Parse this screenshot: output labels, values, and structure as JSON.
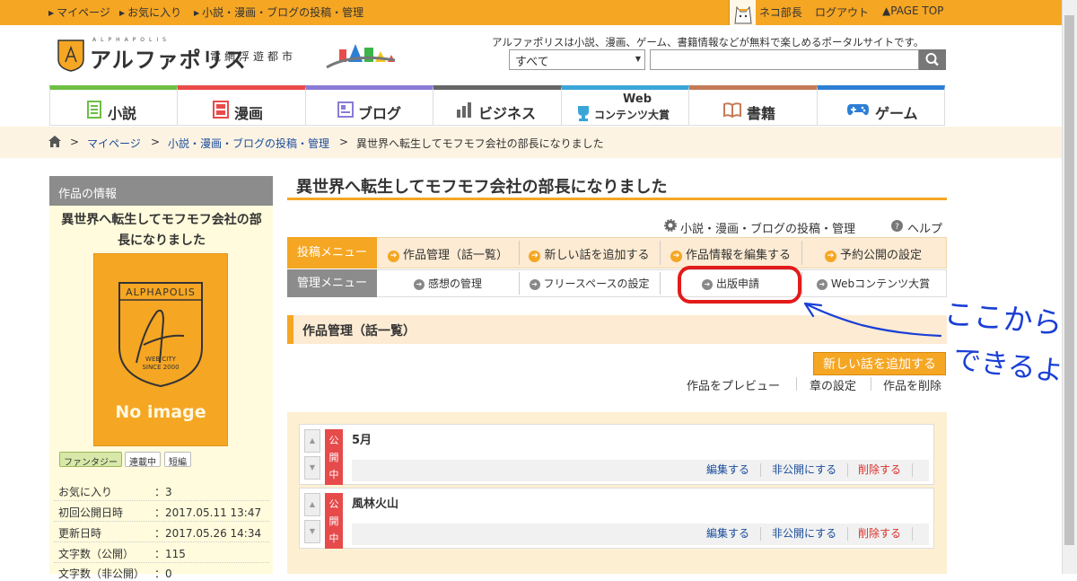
{
  "topbar": {
    "links": [
      "マイページ",
      "お気に入り",
      "小説・漫画・ブログの投稿・管理"
    ],
    "username": "ネコ部長",
    "logout": "ログアウト",
    "pagetop": "▲PAGE TOP"
  },
  "header": {
    "logo_small": "ALPHAPOLIS",
    "logo_name": "アルファポリス",
    "logo_sub": "電網浮遊都市",
    "tagline": "アルファポリスは小説、漫画、ゲーム、書籍情報などが無料で楽しめるポータルサイトです。",
    "search_select": "すべて"
  },
  "nav": [
    "小説",
    "漫画",
    "ブログ",
    "ビジネス",
    "Web",
    "コンテンツ大賞",
    "書籍",
    "ゲーム"
  ],
  "breadcrumb": [
    "マイページ",
    "小説・漫画・ブログの投稿・管理",
    "異世界へ転生してモフモフ会社の部長になりました"
  ],
  "sidebar": {
    "heading": "作品の情報",
    "title_line1": "異世界へ転生してモフモフ会社の部",
    "title_line2": "長になりました",
    "cover_brand": "ALPHAPOLIS",
    "cover_web": "WEB CITY",
    "cover_since": "SINCE 2000",
    "no_image": "No image",
    "tags": [
      "ファンタジー",
      "連載中",
      "短編"
    ],
    "info": [
      {
        "k": "お気に入り",
        "v": "：3"
      },
      {
        "k": "初回公開日時",
        "v": "：2017.05.11 13:47"
      },
      {
        "k": "更新日時",
        "v": "：2017.05.26 14:34"
      },
      {
        "k": "文字数（公開）",
        "v": "：115"
      },
      {
        "k": "文字数（非公開）",
        "v": "：0"
      }
    ]
  },
  "main": {
    "title": "異世界へ転生してモフモフ会社の部長になりました",
    "link_manage": "小説・漫画・ブログの投稿・管理",
    "link_help": "ヘルプ",
    "post_menu": "投稿メニュー",
    "post_items": [
      "作品管理（話一覧）",
      "新しい話を追加する",
      "作品情報を編集する",
      "予約公開の設定"
    ],
    "admin_menu": "管理メニュー",
    "admin_items": [
      "感想の管理",
      "フリースペースの設定",
      "出版申請",
      "Webコンテンツ大賞"
    ],
    "section_title": "作品管理（話一覧）",
    "add_button": "新しい話を追加する",
    "sub_links": [
      "作品をプレビュー",
      "章の設定",
      "作品を削除"
    ],
    "entries": [
      {
        "status": [
          "公",
          "開",
          "中"
        ],
        "title": "5月",
        "actions": [
          "編集する",
          "非公開にする",
          "削除する"
        ]
      },
      {
        "status": [
          "公",
          "開",
          "中"
        ],
        "title": "風林火山",
        "actions": [
          "編集する",
          "非公開にする",
          "削除する"
        ]
      }
    ]
  },
  "annotation": {
    "line1": "ここから",
    "line2": "できるよ。",
    "color": "#1a3fd6",
    "highlight_color": "#e21b1b"
  },
  "colors": {
    "accent": "#f5a623",
    "status_red": "#e64a4a",
    "delete_red": "#d9302c",
    "link_blue": "#1a4c9c"
  }
}
